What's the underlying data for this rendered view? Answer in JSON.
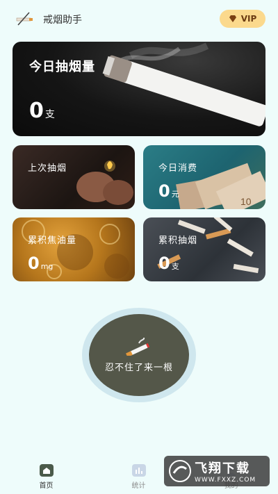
{
  "header": {
    "title": "戒烟助手",
    "vip_label": "VIP"
  },
  "cards": {
    "today": {
      "title": "今日抽烟量",
      "value": "0",
      "unit": "支"
    },
    "last_smoke": {
      "title": "上次抽烟"
    },
    "today_cost": {
      "title": "今日消费",
      "value": "0",
      "unit": "元"
    },
    "tar": {
      "title": "累积焦油量",
      "value": "0",
      "unit": "mg"
    },
    "total_smoked": {
      "title": "累积抽烟",
      "value": "0",
      "unit": "支"
    }
  },
  "craving_button": {
    "label": "忍不住了来一根"
  },
  "tabbar": {
    "tabs": [
      {
        "label": "首页",
        "active": true
      },
      {
        "label": "统计",
        "active": false
      },
      {
        "label": "我的",
        "active": false
      }
    ]
  },
  "watermark": {
    "top": "飞翔下载",
    "bottom": "WWW.FXXZ.COM"
  },
  "colors": {
    "background": "#eefcfb",
    "vip": "#fbd98d",
    "craving": "#545749"
  }
}
